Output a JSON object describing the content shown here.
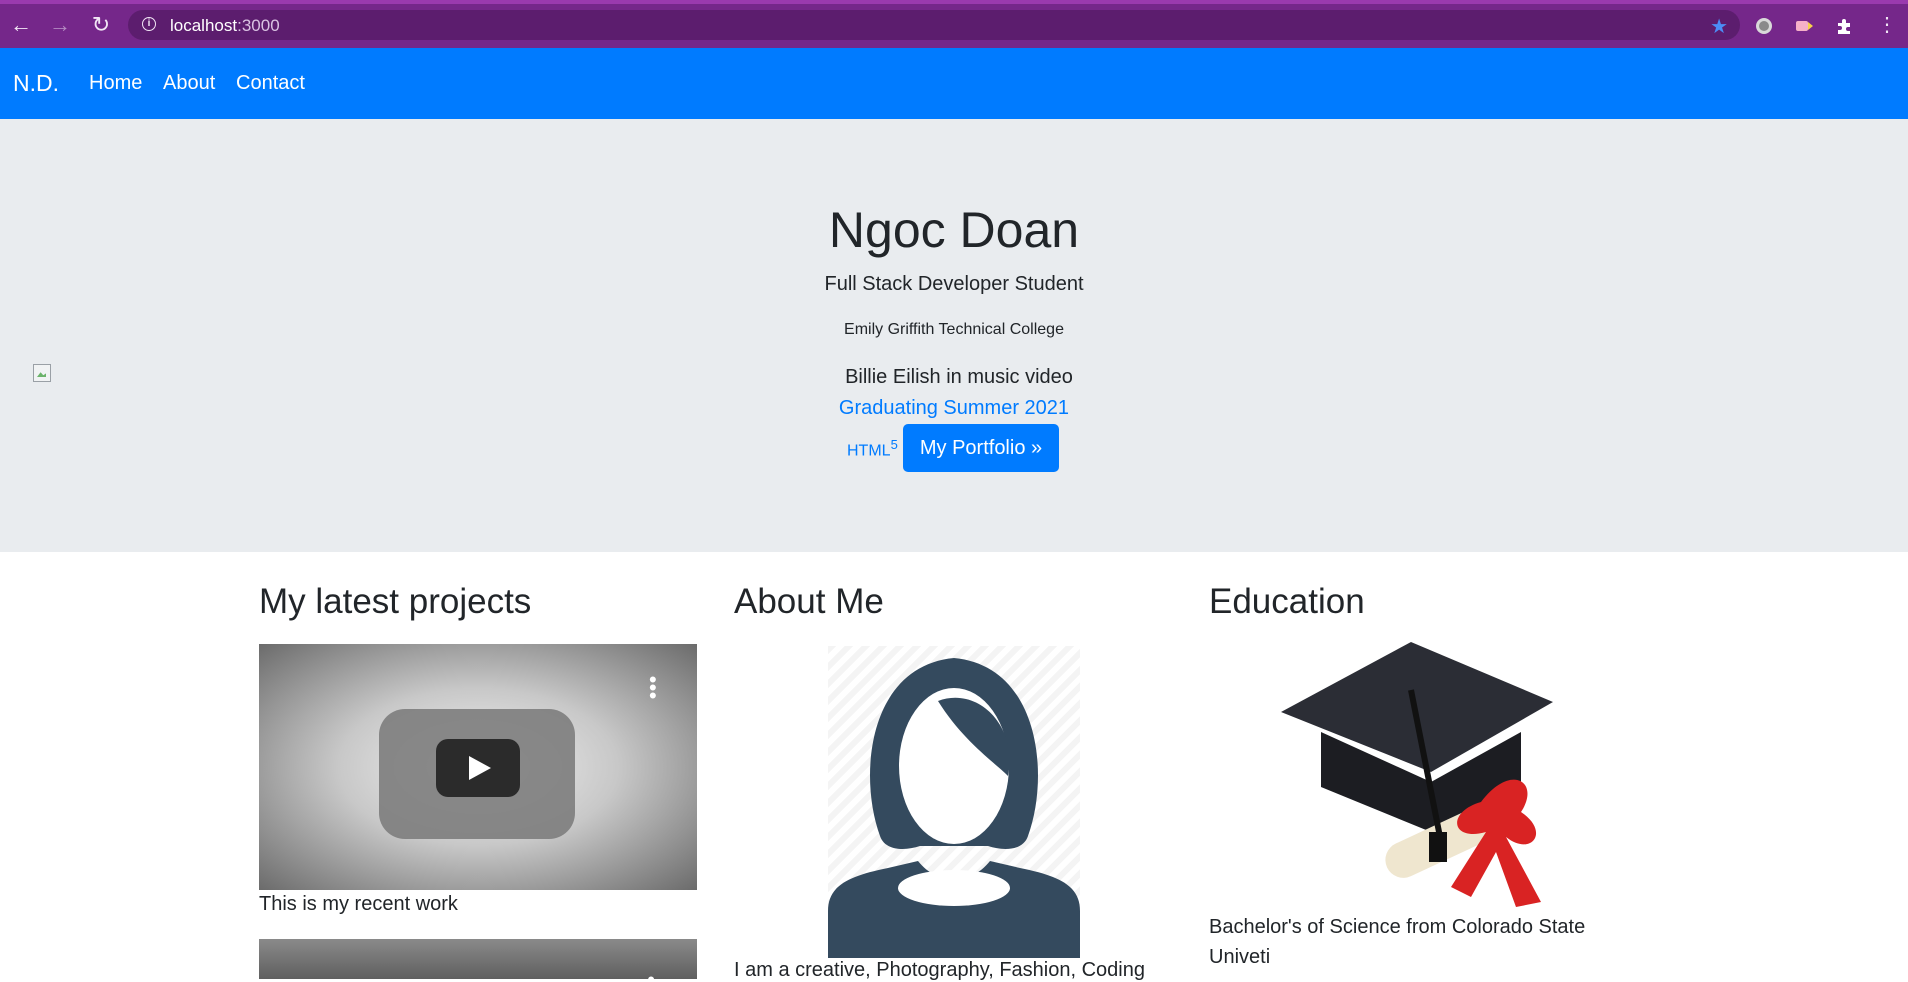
{
  "browser": {
    "url_host": "localhost",
    "url_port": ":3000",
    "icons": [
      "back-arrow-icon",
      "forward-arrow-icon",
      "reload-icon",
      "info-icon",
      "star-icon",
      "extension-icon",
      "puzzle-icon",
      "menu-icon"
    ]
  },
  "navbar": {
    "brand": "N.D.",
    "links": [
      "Home",
      "About",
      "Contact"
    ],
    "bg_color": "#007bff"
  },
  "hero": {
    "title": "Ngoc Doan",
    "subtitle": "Full Stack Developer Student",
    "college": "Emily Griffith Technical College",
    "image_alt": "Billie Eilish in music video",
    "graduating": "Graduating Summer 2021",
    "html_label": "HTML",
    "html_sup": "5",
    "button": "My Portfolio »",
    "bg_color": "#e9ecef"
  },
  "projects": {
    "heading": "My latest projects",
    "caption": "This is my recent work"
  },
  "about": {
    "heading": "About Me",
    "text": "I am a creative, Photography, Fashion, Coding"
  },
  "education": {
    "heading": "Education",
    "text": "Bachelor's of Science from Colorado State Univeti"
  }
}
